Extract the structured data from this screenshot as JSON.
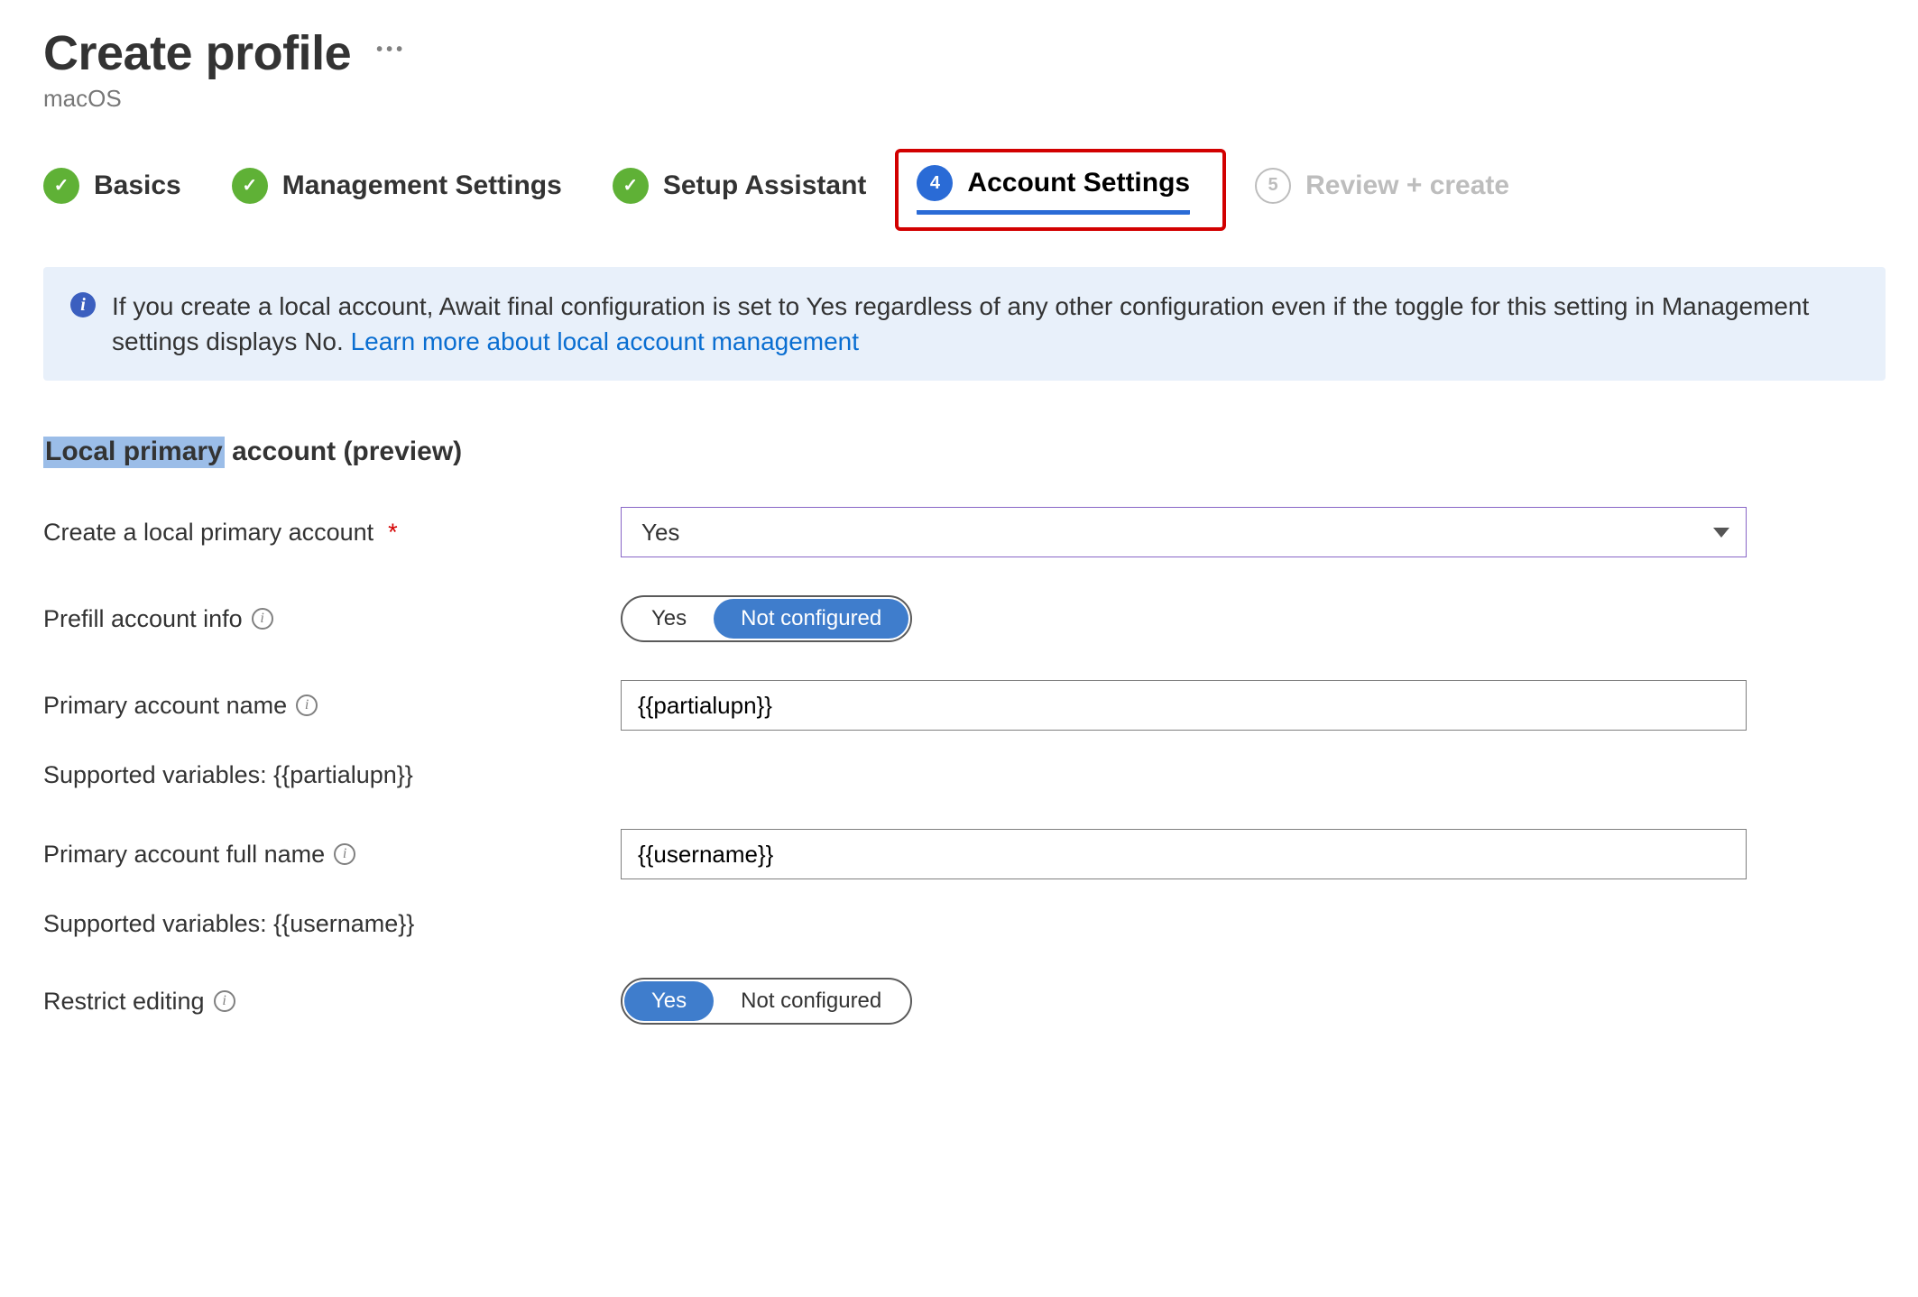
{
  "header": {
    "title": "Create profile",
    "subtitle": "macOS"
  },
  "steps": {
    "basics": {
      "label": "Basics"
    },
    "mgmt": {
      "label": "Management Settings"
    },
    "setup": {
      "label": "Setup Assistant"
    },
    "account": {
      "number": "4",
      "label": "Account Settings"
    },
    "review": {
      "number": "5",
      "label": "Review + create"
    }
  },
  "info": {
    "text_before_link": "If you create a local account, Await final configuration is set to Yes regardless of any other configuration even if the toggle for this setting in Management settings displays No. ",
    "link_text": "Learn more about local account management"
  },
  "section": {
    "highlighted_prefix": "Local primary",
    "rest": " account (preview)"
  },
  "form": {
    "create_local": {
      "label": "Create a local primary account",
      "value": "Yes"
    },
    "prefill": {
      "label": "Prefill account info",
      "opt_yes": "Yes",
      "opt_nc": "Not configured",
      "selected": "nc"
    },
    "primary_name": {
      "label": "Primary account name",
      "value": "{{partialupn}}",
      "hint": "Supported variables: {{partialupn}}"
    },
    "primary_full": {
      "label": "Primary account full name",
      "value": "{{username}}",
      "hint": "Supported variables: {{username}}"
    },
    "restrict": {
      "label": "Restrict editing",
      "opt_yes": "Yes",
      "opt_nc": "Not configured",
      "selected": "yes"
    }
  }
}
